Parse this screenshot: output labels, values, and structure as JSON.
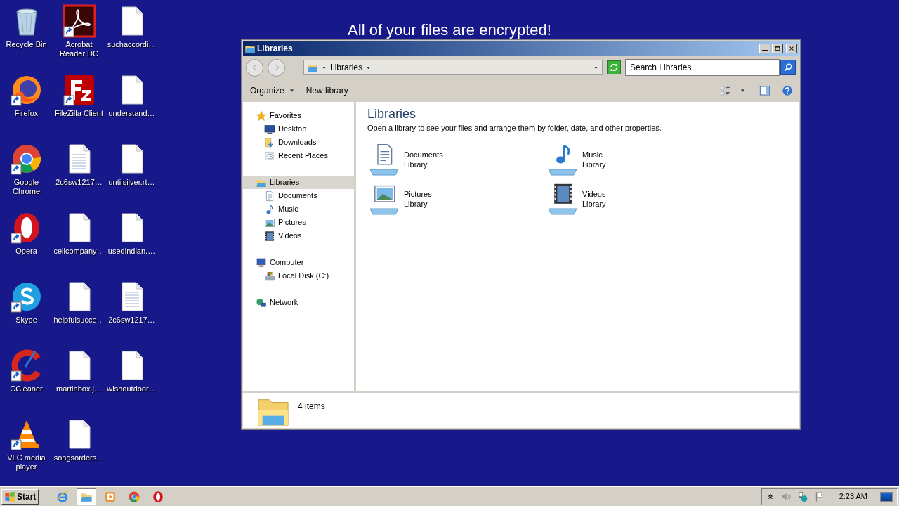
{
  "banner": "All of your files are encrypted!",
  "desktop_icons": [
    {
      "label": "Recycle Bin",
      "kind": "bin",
      "shortcut": false
    },
    {
      "label": "Firefox",
      "kind": "firefox",
      "shortcut": true
    },
    {
      "label": "Google Chrome",
      "kind": "chrome",
      "shortcut": true
    },
    {
      "label": "Opera",
      "kind": "opera",
      "shortcut": true
    },
    {
      "label": "Skype",
      "kind": "skype",
      "shortcut": true
    },
    {
      "label": "CCleaner",
      "kind": "ccleaner",
      "shortcut": true
    },
    {
      "label": "VLC media player",
      "kind": "vlc",
      "shortcut": true
    },
    {
      "label": "Acrobat Reader DC",
      "kind": "acrobat",
      "shortcut": true
    },
    {
      "label": "FileZilla Client",
      "kind": "filezilla",
      "shortcut": true
    },
    {
      "label": "2c6sw1217…",
      "kind": "textfile",
      "shortcut": false
    },
    {
      "label": "cellcompany…",
      "kind": "file",
      "shortcut": false
    },
    {
      "label": "helpfulsucce…",
      "kind": "file",
      "shortcut": false
    },
    {
      "label": "martinbox.j…",
      "kind": "file",
      "shortcut": false
    },
    {
      "label": "songsorders…",
      "kind": "file",
      "shortcut": false
    },
    {
      "label": "suchaccordi…",
      "kind": "file",
      "shortcut": false
    },
    {
      "label": "understand…",
      "kind": "file",
      "shortcut": false
    },
    {
      "label": "untilsilver.rt…",
      "kind": "file",
      "shortcut": false
    },
    {
      "label": "usedindian.…",
      "kind": "file",
      "shortcut": false
    },
    {
      "label": "2c6sw1217…",
      "kind": "textfile",
      "shortcut": false
    },
    {
      "label": "wishoutdoor…",
      "kind": "file",
      "shortcut": false
    }
  ],
  "window": {
    "title": "Libraries",
    "address": {
      "path": [
        "Libraries"
      ]
    },
    "search": {
      "placeholder": "Search Libraries"
    },
    "toolbar": [
      {
        "label": "Organize",
        "dropdown": true
      },
      {
        "label": "New library",
        "dropdown": false
      }
    ],
    "nav": [
      {
        "label": "Favorites",
        "kind": "star",
        "selected": false,
        "children": [
          {
            "label": "Desktop",
            "kind": "desktop",
            "selected": false
          },
          {
            "label": "Downloads",
            "kind": "downloads",
            "selected": false
          },
          {
            "label": "Recent Places",
            "kind": "recent",
            "selected": false
          }
        ]
      },
      {
        "label": "Libraries",
        "kind": "libraries",
        "selected": true,
        "children": [
          {
            "label": "Documents",
            "kind": "document",
            "selected": false
          },
          {
            "label": "Music",
            "kind": "music",
            "selected": false
          },
          {
            "label": "Pictures",
            "kind": "pictures",
            "selected": false
          },
          {
            "label": "Videos",
            "kind": "videos",
            "selected": false
          }
        ]
      },
      {
        "label": "Computer",
        "kind": "computer",
        "selected": false,
        "children": [
          {
            "label": "Local Disk (C:)",
            "kind": "disk",
            "selected": false
          }
        ]
      },
      {
        "label": "Network",
        "kind": "network",
        "selected": false
      }
    ],
    "content": {
      "heading": "Libraries",
      "description": "Open a library to see your files and arrange them by folder, date, and other properties.",
      "items": [
        {
          "name": "Documents",
          "type": "Library",
          "kind": "document"
        },
        {
          "name": "Music",
          "type": "Library",
          "kind": "music"
        },
        {
          "name": "Pictures",
          "type": "Library",
          "kind": "pictures"
        },
        {
          "name": "Videos",
          "type": "Library",
          "kind": "videos"
        }
      ]
    },
    "details": {
      "count": "4 items"
    }
  },
  "taskbar": {
    "start": "Start",
    "apps": [
      {
        "kind": "ie",
        "active": false
      },
      {
        "kind": "explorer",
        "active": true
      },
      {
        "kind": "media",
        "active": false
      },
      {
        "kind": "chrome",
        "active": false
      },
      {
        "kind": "opera",
        "active": false
      }
    ],
    "time": "2:23 AM"
  }
}
